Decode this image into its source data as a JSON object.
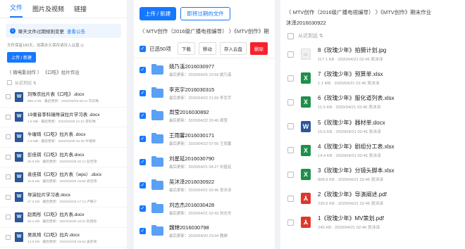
{
  "panel1": {
    "tabs": [
      "文件",
      "图片及视频",
      "链接"
    ],
    "notice_text": "聊天文件过期规则变更",
    "notice_link": "查看公告",
    "expiry_note": "文件保留180天，如需永久保存请存入云盘 ◎",
    "upload_label": "上传 / 新建",
    "breadcrumb": "〈  微电影创作 〉 《口吃》拉片作业",
    "select_all": "从近到远 ⇅",
    "files": [
      {
        "name": "刘殊衣拉片表《口吃》.docx",
        "sub": "880.2 KB · 最后更新：2022/03/29 08:14 刘衣殊"
      },
      {
        "name": "19录音李科瑞导演拉片学习表 .docx",
        "sub": "1.8 MB · 最后更新：2022/03/28 21:21 李科瑞"
      },
      {
        "name": "牛璀琦《口吃》拉片表 .docx",
        "sub": "1.6 MB · 最后更新：2022/03/28 20:36 牛璀琦"
      },
      {
        "name": "彭佳琪《口吃》拉片表.docx",
        "sub": "20.5 KB · 最后更新：2022/03/28 20:14 彭佳琪"
      },
      {
        "name": "袁佳祺《口吃》拉片表（wps）.docx",
        "sub": "15.9 KB · 最后更新：2022/03/28 19:50 袁佳祺"
      },
      {
        "name": "导演拉片学习表.docx",
        "sub": "27.2 KB · 最后更新：2022/03/28 17:13 卢曜宁"
      },
      {
        "name": "赵雨彤《口吃》拉片表.docx",
        "sub": "26.1 KB · 最后更新：2022/03/28 16:01 赵雨彤"
      },
      {
        "name": "吴凯琦《口吃》拉片.docx",
        "sub": "13.6 KB · 最后更新：2022/03/28 15:52 吴凯琦"
      }
    ]
  },
  "panel2": {
    "upload_label": "上传 / 新建",
    "expiring_label": "即将过期的文件",
    "breadcrumb": "〈  MTV创作（2016级广播电视编导） 〉《MTV创作》期",
    "selected_label": "已选50项",
    "actions": [
      "下载",
      "移动",
      "存入云盘",
      "删除"
    ],
    "folders": [
      {
        "name": "姚乃溪2016030977",
        "sub": "最后更新：2020/04/25 23:59 姚乃溪"
      },
      {
        "name": "李克宇2016030315",
        "sub": "最后更新：2020/04/22 21:59 李克宇"
      },
      {
        "name": "周莹2016030892",
        "sub": "最后更新：2020/04/22 20:46 周莹"
      },
      {
        "name": "王雨馨2016030171",
        "sub": "最后更新：2020/04/22 07:56 王雨馨"
      },
      {
        "name": "刘星延2016030790",
        "sub": "最后更新：2020/04/21 04:27 刘星延"
      },
      {
        "name": "吴沐泽2016030922",
        "sub": "最后更新：2020/04/21 02:46 吴沐泽"
      },
      {
        "name": "刘志杰2016030428",
        "sub": "最后更新：2020/04/21 02:43 刘志杰"
      },
      {
        "name": "魏婵2016030798",
        "sub": "最后更新：2020/04/20 23:04 魏婵"
      }
    ]
  },
  "panel3": {
    "breadcrumb": "〈  MTV创作（2016级广播电视编导） 〉《MTV创作》期末作业",
    "folder_title": "沐泽2016030922",
    "select_all": "从近到远 ⇅",
    "files": [
      {
        "name": "8《玫瑰少年》拍摄计划.jpg",
        "sub": "117.1 KB · 2020/04/21 02:46 吴沐泽",
        "type": "jpg"
      },
      {
        "name": "7《玫瑰少年》预算单.xlsx",
        "sub": "1.1 MB · 2020/04/21 02:46 吴沐泽",
        "type": "xlsx"
      },
      {
        "name": "6《玫瑰少年》服化道列表.xlsx",
        "sub": "11.5 KB · 2020/04/21 02:46 吴沐泽",
        "type": "xlsx"
      },
      {
        "name": "5《玫瑰少年》器材单.docx",
        "sub": "15.5 KB · 2020/04/21 02:46 吴沐泽",
        "type": "docx"
      },
      {
        "name": "4《玫瑰少年》剧组分工表.xlsx",
        "sub": "14.4 KB · 2020/04/21 02:46 吴沐泽",
        "type": "xlsx"
      },
      {
        "name": "3《玫瑰少年》分镜头脚本.xlsx",
        "sub": "868.9 KB · 2020/04/21 02:46 吴沐泽",
        "type": "xlsx"
      },
      {
        "name": "2《玫瑰少年》导演阐述.pdf",
        "sub": "236.6 KB · 2020/04/21 02:46 吴沐泽",
        "type": "pdf"
      },
      {
        "name": "1《玫瑰少年》MV策划.pdf",
        "sub": "245 KB · 2020/04/21 02:46 吴沐泽",
        "type": "pdf"
      }
    ]
  }
}
